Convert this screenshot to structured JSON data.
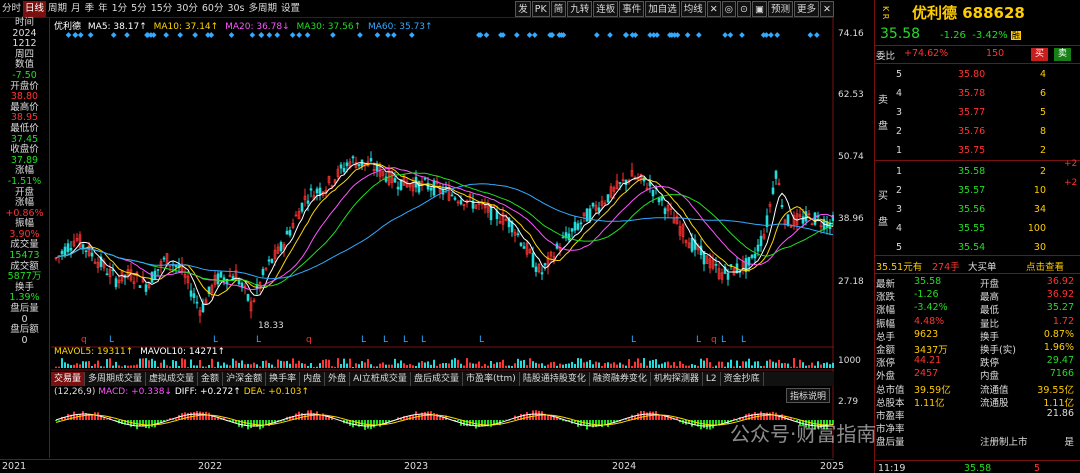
{
  "toolbar": {
    "items": [
      "分时",
      "日线",
      "周期",
      "月",
      "季",
      "年",
      "1分",
      "5分",
      "15分",
      "30分",
      "60分",
      "30s",
      "多周期",
      "设置"
    ],
    "right_items": [
      "发",
      "PK",
      "简",
      "九转",
      "连板",
      "事件",
      "加自选",
      "均线",
      "✕",
      "◎",
      "⊙",
      "▣",
      "预测",
      "更多",
      "✕"
    ]
  },
  "left_panel": [
    {
      "label": "时间",
      "color": "wh"
    },
    {
      "value": "2024",
      "color": "wh"
    },
    {
      "value": "1212",
      "color": "wh"
    },
    {
      "value": "周四",
      "color": "wh"
    },
    {
      "label": "数值",
      "color": "wh"
    },
    {
      "value": "-7.50",
      "color": "gn"
    },
    {
      "label": "开盘价",
      "color": "wh"
    },
    {
      "value": "38.80",
      "color": "rd"
    },
    {
      "label": "最高价",
      "color": "wh"
    },
    {
      "value": "38.95",
      "color": "rd"
    },
    {
      "label": "最低价",
      "color": "wh"
    },
    {
      "value": "37.45",
      "color": "gn"
    },
    {
      "label": "收盘价",
      "color": "wh"
    },
    {
      "value": "37.89",
      "color": "gn"
    },
    {
      "label": "涨幅",
      "color": "wh"
    },
    {
      "value": "-1.51%",
      "color": "gn"
    },
    {
      "label": "开盘",
      "color": "wh"
    },
    {
      "label": "涨幅",
      "color": "wh"
    },
    {
      "value": "+0.86%",
      "color": "rd"
    },
    {
      "label": "振幅",
      "color": "wh"
    },
    {
      "value": "3.90%",
      "color": "rd"
    },
    {
      "label": "成交量",
      "color": "wh"
    },
    {
      "value": "15473",
      "color": "gn"
    },
    {
      "label": "成交额",
      "color": "wh"
    },
    {
      "value": "5877万",
      "color": "gn"
    },
    {
      "label": "换手",
      "color": "wh"
    },
    {
      "value": "1.39%",
      "color": "gn"
    },
    {
      "label": "盘后量",
      "color": "wh"
    },
    {
      "value": "0",
      "color": "wh"
    },
    {
      "label": "盘后额",
      "color": "wh"
    },
    {
      "value": "0",
      "color": "wh"
    }
  ],
  "legend": {
    "stock": "优利德",
    "ma5": "MA5: 38.17↑",
    "ma10": "MA10: 37.14↑",
    "ma20": "MA20: 36.78↓",
    "ma30": "MA30: 37.56↑",
    "ma60": "MA60: 35.73↑"
  },
  "y_axis": [
    "74.16",
    "62.53",
    "50.74",
    "38.96",
    "27.18"
  ],
  "min_label": "18.33",
  "vol_legend": {
    "mavol5": "MAVOL5: 19311↑",
    "mavol10": "MAVOL10: 14271↑"
  },
  "vol_axis": [
    "1000"
  ],
  "indicator_tabs": [
    "交易量",
    "多周期成交量",
    "虚拟成交量",
    "金额",
    "沪深金额",
    "换手率",
    "内盘",
    "外盘",
    "AI立桩成交量",
    "盘后成交量",
    "市盈率(ttm)",
    "陆股通持股变化",
    "融资融券变化",
    "机构探测器",
    "L2",
    "资金抄底"
  ],
  "macd_legend": {
    "params": "(12,26,9)",
    "macd": "MACD: +0.338↓",
    "diff": "DIFF: +0.272↑",
    "dea": "DEA: +0.103↑"
  },
  "macd_help": "指标说明",
  "macd_axis": [
    "2.79"
  ],
  "years": [
    "2021",
    "2022",
    "2023",
    "2024",
    "2025"
  ],
  "right": {
    "side_marks": "K R",
    "name": "优利德",
    "code": "688628",
    "price": "35.58",
    "change": "-1.26",
    "pct": "-3.42%",
    "tag": "融",
    "weibi_label": "委比",
    "weibi": "+74.62%",
    "weicha": "150",
    "buy_btn": "买",
    "sell_btn": "卖",
    "sell_label": "卖盘",
    "asks": [
      [
        "5",
        "35.80",
        "4"
      ],
      [
        "4",
        "35.78",
        "6"
      ],
      [
        "3",
        "35.77",
        "5"
      ],
      [
        "2",
        "35.76",
        "8"
      ],
      [
        "1",
        "35.75",
        "2"
      ]
    ],
    "buy_label": "买盘",
    "bids": [
      [
        "1",
        "35.58",
        "2"
      ],
      [
        "2",
        "35.57",
        "10"
      ],
      [
        "3",
        "35.56",
        "34"
      ],
      [
        "4",
        "35.55",
        "100"
      ],
      [
        "5",
        "35.54",
        "30"
      ]
    ],
    "bid_marks": [
      "+2",
      "+2"
    ],
    "bigdeal": {
      "v1": "35.51元有",
      "v2": "274手",
      "v3": "大买单",
      "link": "点击查看"
    },
    "stats": [
      [
        "最新",
        "35.58",
        "开盘",
        "36.92"
      ],
      [
        "涨跌",
        "-1.26",
        "最高",
        "36.92"
      ],
      [
        "涨幅",
        "-3.42%",
        "最低",
        "35.27"
      ],
      [
        "振幅",
        "4.48%",
        "量比",
        "1.72"
      ],
      [
        "总手",
        "9623",
        "换手",
        "0.87%"
      ],
      [
        "金额",
        "3437万",
        "换手(实)",
        "1.96%"
      ],
      [
        "涨停",
        "44.21",
        "跌停",
        "29.47"
      ],
      [
        "外盘",
        "2457",
        "内盘",
        "7166"
      ],
      [
        "总市值",
        "39.59亿",
        "流通值",
        "39.55亿"
      ],
      [
        "总股本",
        "1.11亿",
        "流通股",
        "1.11亿"
      ],
      [
        "市盈率",
        "",
        "",
        "21.86"
      ],
      [
        "市净率",
        "",
        "",
        ""
      ],
      [
        "盘后量",
        "",
        "注册制上市",
        "是"
      ]
    ],
    "footer": [
      "11:19",
      "35.58",
      "5"
    ]
  },
  "watermark": "公众号·财富指南",
  "chart_data": {
    "type": "line",
    "title": "",
    "xlabel": "",
    "ylabel": "",
    "ylim": [
      18,
      76
    ],
    "x": [
      "2021",
      "2022",
      "2023",
      "2024",
      "2025"
    ],
    "series": [
      {
        "name": "MA5",
        "values": []
      }
    ]
  }
}
